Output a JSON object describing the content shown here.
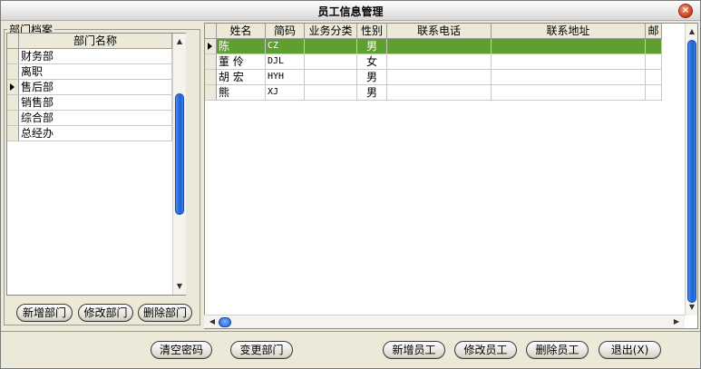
{
  "window": {
    "title": "员工信息管理",
    "close_glyph": "×"
  },
  "dept_panel": {
    "group_label": "部门档案",
    "column_header": "部门名称",
    "items": [
      "财务部",
      "离职",
      "售后部",
      "销售部",
      "综合部",
      "总经办"
    ],
    "current_index": 2,
    "buttons": {
      "add": "新增部门",
      "edit": "修改部门",
      "delete": "删除部门"
    }
  },
  "employee_grid": {
    "columns": [
      "姓名",
      "简码",
      "业务分类",
      "性别",
      "联系电话",
      "联系地址",
      "邮"
    ],
    "rows": [
      {
        "name": "陈",
        "code": "CZ",
        "category": "",
        "sex": "男",
        "phone": "",
        "address": "",
        "mail": ""
      },
      {
        "name": "董  伶",
        "code": "DJL",
        "category": "",
        "sex": "女",
        "phone": "",
        "address": "",
        "mail": ""
      },
      {
        "name": "胡  宏",
        "code": "HYH",
        "category": "",
        "sex": "男",
        "phone": "",
        "address": "",
        "mail": ""
      },
      {
        "name": "熊",
        "code": "XJ",
        "category": "",
        "sex": "男",
        "phone": "",
        "address": "",
        "mail": ""
      }
    ],
    "selected_index": 0,
    "selection_color": "#5da030"
  },
  "footer_buttons": {
    "clear_password": "清空密码",
    "change_dept": "变更部门",
    "add_employee": "新增员工",
    "edit_employee": "修改员工",
    "delete_employee": "删除员工",
    "exit": "退出(X)"
  },
  "colors": {
    "scroll_thumb": "#1c5fd0",
    "window_bg": "#ece9d8"
  }
}
